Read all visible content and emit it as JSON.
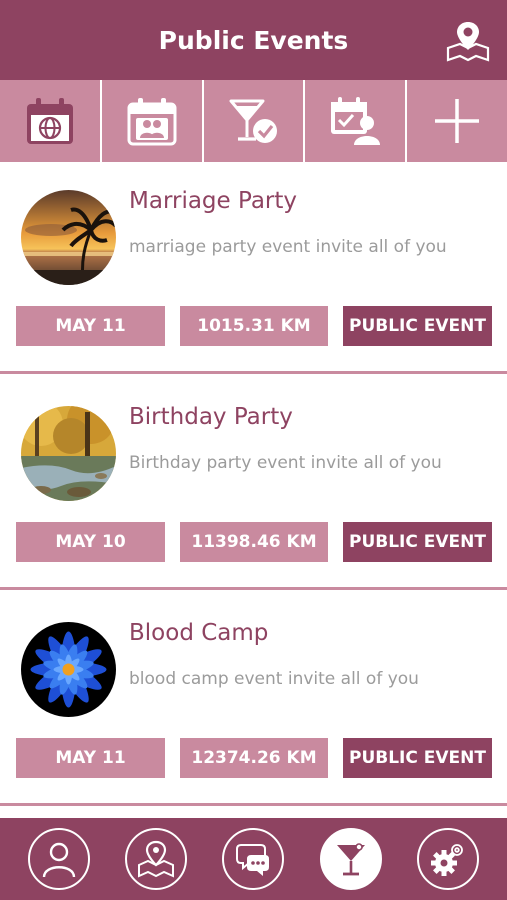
{
  "header": {
    "title": "Public Events",
    "map_icon": "map-pin-icon"
  },
  "tabs": [
    {
      "name": "global-calendar",
      "icon": "calendar-globe-icon"
    },
    {
      "name": "group-calendar",
      "icon": "calendar-group-icon"
    },
    {
      "name": "attending-events",
      "icon": "cocktail-check-icon"
    },
    {
      "name": "invited-events",
      "icon": "calendar-user-icon"
    },
    {
      "name": "add-event",
      "icon": "plus-icon"
    }
  ],
  "events": [
    {
      "title": "Marriage Party",
      "description": "marriage party event invite all of you",
      "date": "MAY 11",
      "distance": "1015.31 KM",
      "type": "PUBLIC EVENT",
      "image": "sunset-beach"
    },
    {
      "title": "Birthday Party",
      "description": "Birthday party event invite all of you",
      "date": "MAY 10",
      "distance": "11398.46 KM",
      "type": "PUBLIC EVENT",
      "image": "autumn-stream"
    },
    {
      "title": "Blood Camp",
      "description": "blood camp event invite all of you",
      "date": "MAY 11",
      "distance": "12374.26 KM",
      "type": "PUBLIC EVENT",
      "image": "blue-flower"
    }
  ],
  "bottom_nav": [
    {
      "name": "profile",
      "icon": "user-icon",
      "active": false
    },
    {
      "name": "map",
      "icon": "map-icon",
      "active": false
    },
    {
      "name": "chat",
      "icon": "chat-icon",
      "active": false
    },
    {
      "name": "events",
      "icon": "cocktail-icon",
      "active": true
    },
    {
      "name": "settings",
      "icon": "gear-icon",
      "active": false
    }
  ],
  "colors": {
    "primary": "#8e4361",
    "secondary": "#c98a9f",
    "text_muted": "#9b9b9b",
    "background": "#ffffff"
  }
}
